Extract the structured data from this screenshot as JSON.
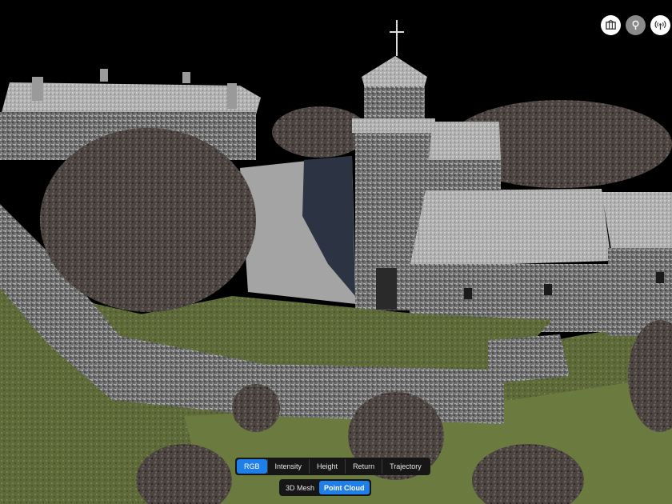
{
  "toolbar": {
    "buttons": [
      {
        "icon": "map-layers-icon"
      },
      {
        "icon": "location-pin-icon"
      },
      {
        "icon": "antenna-signal-icon"
      }
    ]
  },
  "color_modes": {
    "items": [
      "RGB",
      "Intensity",
      "Height",
      "Return",
      "Trajectory"
    ],
    "selected": "RGB"
  },
  "view_modes": {
    "items": [
      "3D Mesh",
      "Point Cloud"
    ],
    "selected": "Point Cloud"
  },
  "colors": {
    "accent": "#1f7ee8",
    "bar_bg": "#161616"
  }
}
